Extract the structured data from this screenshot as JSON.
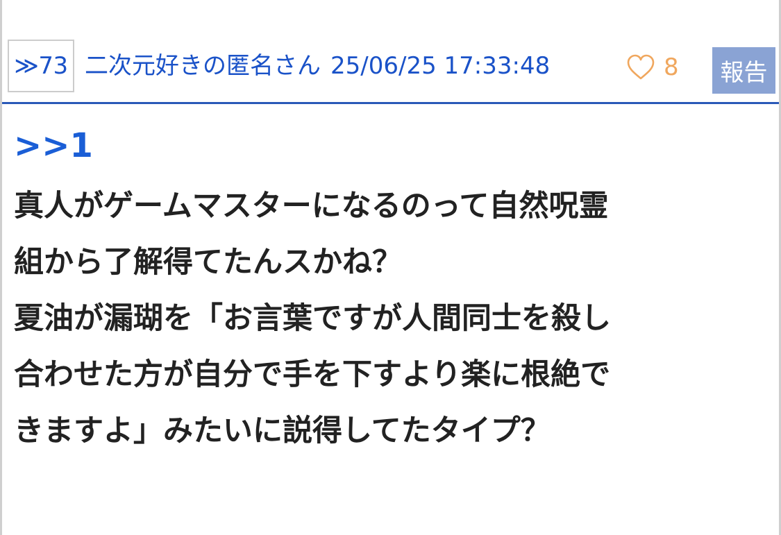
{
  "post": {
    "number": "≫73",
    "author": "二次元好きの匿名さん",
    "timestamp": "25/06/25 17:33:48",
    "like_count": "8",
    "report_label": "報告",
    "reply_anchor": ">>1",
    "body_lines": [
      "真人がゲームマスターになるのって自然呪霊",
      "組から了解得てたんスかね？",
      "夏油が漏瑚を「お言葉ですが人間同士を殺し",
      "合わせた方が自分で手を下すより楽に根絶で",
      "きますよ」みたいに説得してたタイプ？"
    ]
  },
  "colors": {
    "link_blue": "#1a52c8",
    "like_orange": "#f0a75e",
    "report_bg": "#8aa3d4",
    "divider": "#2a59b8",
    "text": "#222222"
  },
  "icons": {
    "like": "heart-icon"
  }
}
